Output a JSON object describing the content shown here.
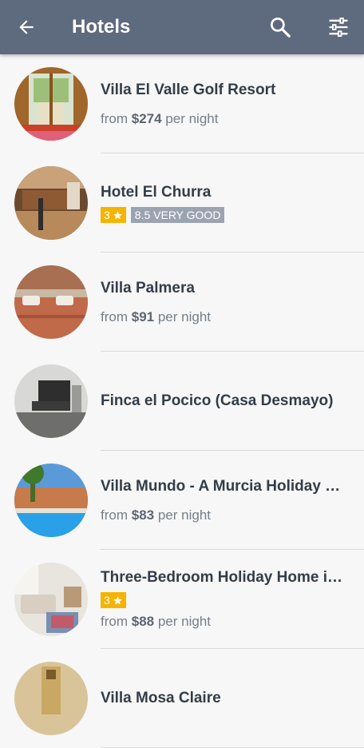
{
  "header": {
    "title": "Hotels",
    "back_icon": "arrow-left-icon",
    "search_icon": "search-icon",
    "filter_icon": "sliders-icon",
    "background": "#5e6a7d"
  },
  "hotels": [
    {
      "name": "Villa El Valle Golf Resort",
      "price_prefix": "from",
      "price": "$274",
      "price_suffix": "per night"
    },
    {
      "name": "Hotel El Churra",
      "stars": "3",
      "rating": "8.5 VERY GOOD"
    },
    {
      "name": "Villa Palmera",
      "price_prefix": "from",
      "price": "$91",
      "price_suffix": "per night"
    },
    {
      "name": "Finca el Pocico (Casa Desmayo)"
    },
    {
      "name": "Villa Mundo - A Murcia Holiday Rentals Property",
      "price_prefix": "from",
      "price": "$83",
      "price_suffix": "per night"
    },
    {
      "name": "Three-Bedroom Holiday Home in Torre-Pacheco",
      "stars": "3",
      "price_prefix": "from",
      "price": "$88",
      "price_suffix": "per night"
    },
    {
      "name": "Villa Mosa Claire"
    }
  ]
}
